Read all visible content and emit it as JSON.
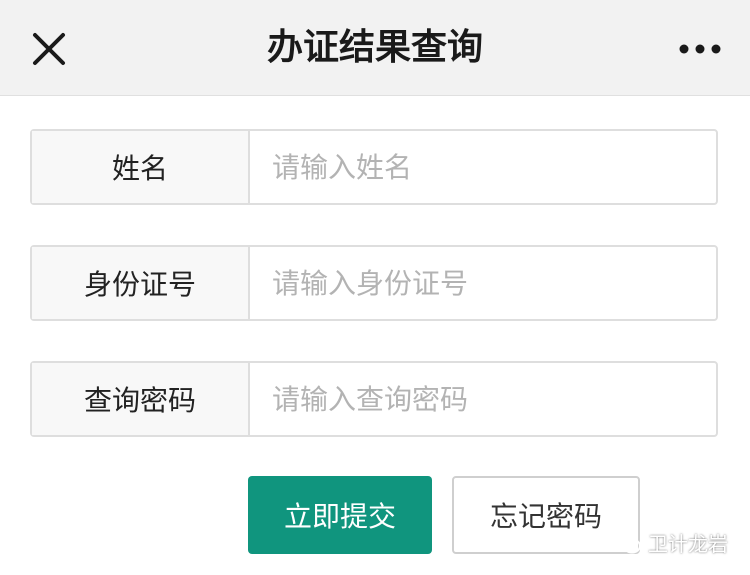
{
  "header": {
    "title": "办证结果查询",
    "close_icon": "close-icon",
    "more_icon": "more-horizontal-icon"
  },
  "form": {
    "name": {
      "label": "姓名",
      "placeholder": "请输入姓名",
      "value": ""
    },
    "id_number": {
      "label": "身份证号",
      "placeholder": "请输入身份证号",
      "value": ""
    },
    "query_password": {
      "label": "查询密码",
      "placeholder": "请输入查询密码",
      "value": ""
    }
  },
  "buttons": {
    "submit_label": "立即提交",
    "forgot_label": "忘记密码"
  },
  "watermark": {
    "text": "卫计龙岩",
    "icon": "wechat-icon"
  },
  "colors": {
    "primary": "#10957e",
    "header_bg": "#f2f2f2",
    "border": "#dedede"
  }
}
